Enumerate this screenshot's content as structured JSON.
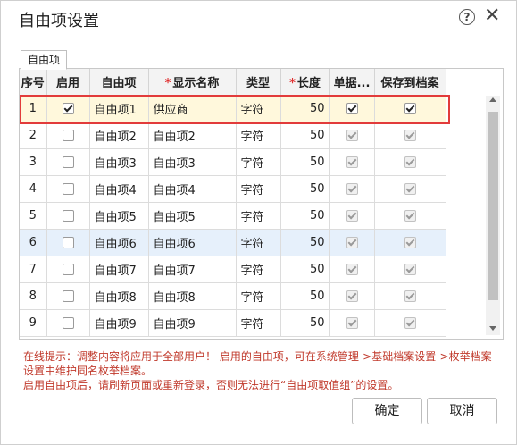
{
  "dialog": {
    "title": "自由项设置"
  },
  "tab": {
    "label": "自由项"
  },
  "table": {
    "headers": {
      "seq": "序号",
      "enabled": "启用",
      "item": "自由项",
      "required_mark": "*",
      "display_name": "显示名称",
      "type": "类型",
      "length": "长度",
      "doc": "单据...",
      "archive": "保存到档案"
    },
    "rows": [
      {
        "seq": "1",
        "enabled": true,
        "item": "自由项1",
        "display_name": "供应商",
        "type": "字符",
        "length": "50",
        "doc": true,
        "archive": true
      },
      {
        "seq": "2",
        "enabled": false,
        "item": "自由项2",
        "display_name": "自由项2",
        "type": "字符",
        "length": "50",
        "doc": true,
        "archive": true
      },
      {
        "seq": "3",
        "enabled": false,
        "item": "自由项3",
        "display_name": "自由项3",
        "type": "字符",
        "length": "50",
        "doc": true,
        "archive": true
      },
      {
        "seq": "4",
        "enabled": false,
        "item": "自由项4",
        "display_name": "自由项4",
        "type": "字符",
        "length": "50",
        "doc": true,
        "archive": true
      },
      {
        "seq": "5",
        "enabled": false,
        "item": "自由项5",
        "display_name": "自由项5",
        "type": "字符",
        "length": "50",
        "doc": true,
        "archive": true
      },
      {
        "seq": "6",
        "enabled": false,
        "item": "自由项6",
        "display_name": "自由项6",
        "type": "字符",
        "length": "50",
        "doc": true,
        "archive": true
      },
      {
        "seq": "7",
        "enabled": false,
        "item": "自由项7",
        "display_name": "自由项7",
        "type": "字符",
        "length": "50",
        "doc": true,
        "archive": true
      },
      {
        "seq": "8",
        "enabled": false,
        "item": "自由项8",
        "display_name": "自由项8",
        "type": "字符",
        "length": "50",
        "doc": true,
        "archive": true
      },
      {
        "seq": "9",
        "enabled": false,
        "item": "自由项9",
        "display_name": "自由项9",
        "type": "字符",
        "length": "50",
        "doc": true,
        "archive": true
      }
    ]
  },
  "hint": {
    "line1": "在线提示：调整内容将应用于全部用户！ 启用的自由项，可在系统管理->基础档案设置->枚举档案设置中维护同名枚举档案。",
    "line2": "启用自由项后，请刷新页面或重新登录，否则无法进行“自由项取值组”的设置。"
  },
  "buttons": {
    "ok": "确定",
    "cancel": "取消"
  },
  "icons": {
    "help": "help-icon",
    "close": "close-icon"
  },
  "colors": {
    "highlight_border": "#e23b3b",
    "hint_text": "#c0392b",
    "selected_row": "#fff8dc",
    "hover_row": "#e6f0fb"
  }
}
